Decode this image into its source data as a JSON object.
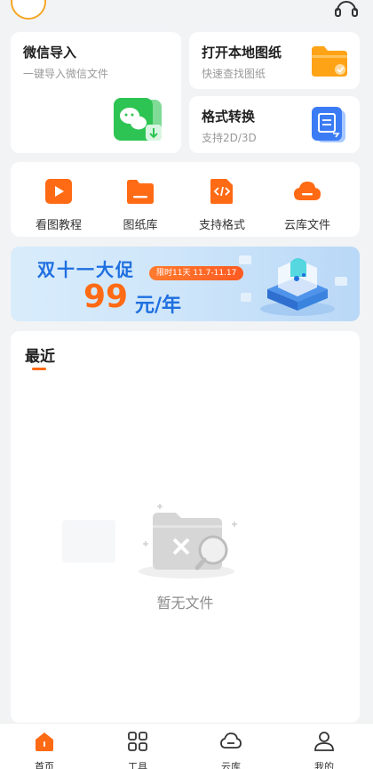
{
  "cards": {
    "wechat_import": {
      "title": "微信导入",
      "subtitle": "一键导入微信文件"
    },
    "open_local": {
      "title": "打开本地图纸",
      "subtitle": "快速查找图纸"
    },
    "format_convert": {
      "title": "格式转换",
      "subtitle": "支持2D/3D"
    }
  },
  "quick_actions": [
    {
      "label": "看图教程",
      "icon": "play-icon"
    },
    {
      "label": "图纸库",
      "icon": "folder-icon"
    },
    {
      "label": "支持格式",
      "icon": "code-file-icon"
    },
    {
      "label": "云库文件",
      "icon": "cloud-icon"
    }
  ],
  "banner": {
    "title": "双十一大促",
    "pill": "限时11天 11.7-11.17",
    "price": "99",
    "unit": "元/年"
  },
  "recent": {
    "tab_title": "最近",
    "empty_text": "暂无文件"
  },
  "bottom_nav": [
    {
      "label": "首页",
      "icon": "home-icon",
      "active": true
    },
    {
      "label": "工具",
      "icon": "grid-icon",
      "active": false
    },
    {
      "label": "云库",
      "icon": "cloud-icon",
      "active": false
    },
    {
      "label": "我的",
      "icon": "user-icon",
      "active": false
    }
  ],
  "colors": {
    "accent": "#ff6a14",
    "wechat_green": "#2ec453",
    "folder_orange": "#ffa316",
    "convert_blue": "#3b7cf5",
    "banner_blue": "#1f6fe0",
    "background": "#f2f3f5"
  }
}
